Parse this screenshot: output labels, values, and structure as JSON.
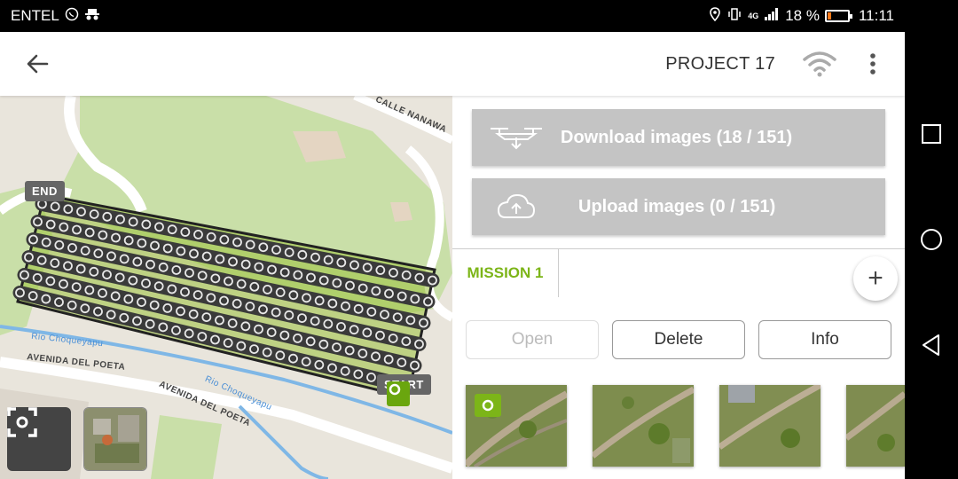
{
  "status_bar": {
    "carrier": "ENTEL",
    "network": "4G",
    "battery_text": "18 %",
    "battery_level": 0.18,
    "time": "11:11",
    "battery_color": "#ff7a1a"
  },
  "app_bar": {
    "back_icon": "arrow-back-icon",
    "title": "PROJECT 17",
    "wifi_icon": "wifi-icon",
    "menu_icon": "more-vert-icon"
  },
  "map": {
    "labels": {
      "end": "END",
      "start": "START",
      "calle_nanawa": "CALLE NANAWA",
      "avenida_del_poeta_1": "AVENIDA DEL POETA",
      "avenida_del_poeta_2": "AVENIDA DEL POETA",
      "rio": "Rio Choqueyapu",
      "rio_2": "Rio Choqueyapu"
    },
    "recenter_icon": "focus-frame-icon",
    "layer_thumb": "satellite-layer-thumbnail"
  },
  "panel": {
    "download_label": "Download images (18 / 151)",
    "upload_label": "Upload images (0 / 151)",
    "tab_label": "MISSION 1",
    "add_label": "+",
    "open_label": "Open",
    "delete_label": "Delete",
    "info_label": "Info",
    "accent_color": "#7cb518",
    "button_bg": "#c4c4c4"
  },
  "nav_bar": {
    "recents_icon": "square-icon",
    "home_icon": "circle-icon",
    "back_icon": "triangle-back-icon"
  }
}
